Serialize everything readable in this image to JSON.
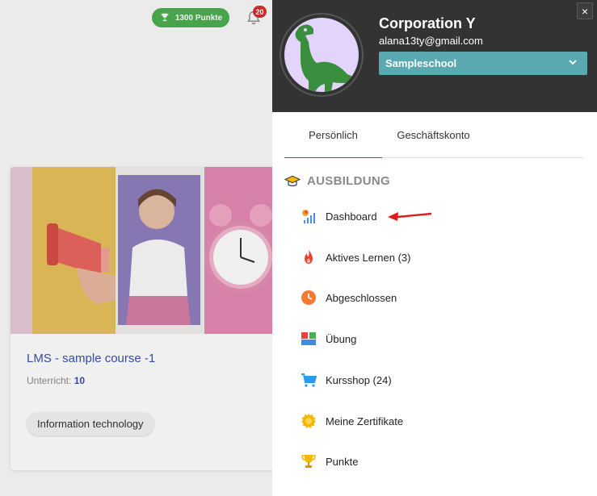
{
  "background": {
    "points_pill": "1300 Punkte",
    "notification_count": "20",
    "course": {
      "title": "LMS - sample course -1",
      "lessons_label": "Unterricht:",
      "lessons_value": "10",
      "tag": "Information technology"
    }
  },
  "drawer": {
    "org_name": "Corporation Y",
    "email": "alana13ty@gmail.com",
    "school_select": "Sampleschool",
    "close_label": "×",
    "tabs": [
      {
        "label": "Persönlich",
        "active": true
      },
      {
        "label": "Geschäftskonto",
        "active": false
      }
    ],
    "section_title": "AUSBILDUNG",
    "menu": [
      {
        "label": "Dashboard",
        "icon": "dashboard-icon"
      },
      {
        "label": "Aktives Lernen (3)",
        "icon": "flame-icon"
      },
      {
        "label": "Abgeschlossen",
        "icon": "clock-icon"
      },
      {
        "label": "Übung",
        "icon": "grid-icon"
      },
      {
        "label": "Kursshop (24)",
        "icon": "cart-icon"
      },
      {
        "label": "Meine Zertifikate",
        "icon": "award-icon"
      },
      {
        "label": "Punkte",
        "icon": "trophy-icon"
      }
    ]
  },
  "colors": {
    "header_bg": "#333333",
    "select_bg": "#5aa8b0",
    "points_green": "#4caf50",
    "link_blue": "#3a4fb5",
    "arrow_red": "#e01b1b"
  }
}
